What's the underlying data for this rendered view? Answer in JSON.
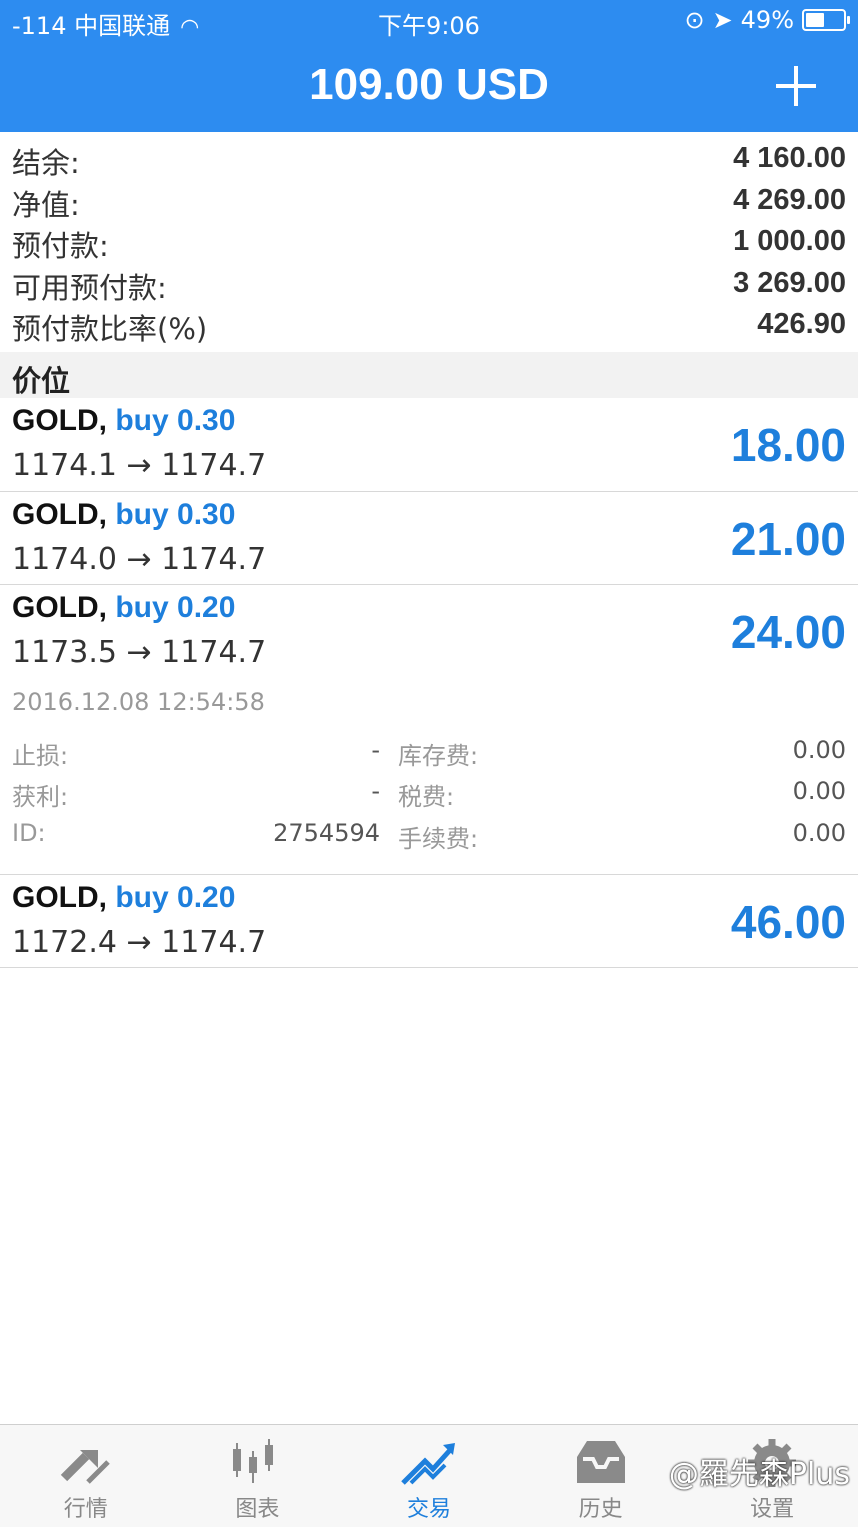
{
  "status_bar": {
    "carrier": "-114 中国联通",
    "time": "下午9:06",
    "battery": "49%",
    "battery_level": 0.49
  },
  "header": {
    "title": "109.00 USD"
  },
  "summary": [
    {
      "label": "结余:",
      "value": "4 160.00"
    },
    {
      "label": "净值:",
      "value": "4 269.00"
    },
    {
      "label": "预付款:",
      "value": "1 000.00"
    },
    {
      "label": "可用预付款:",
      "value": "3 269.00"
    },
    {
      "label": "预付款比率(%)",
      "value": "426.90"
    }
  ],
  "section_title": "价位",
  "positions": [
    {
      "symbol": "GOLD,",
      "side": "buy 0.30",
      "prices": "1174.1 → 1174.7",
      "profit": "18.00"
    },
    {
      "symbol": "GOLD,",
      "side": "buy 0.30",
      "prices": "1174.0 → 1174.7",
      "profit": "21.00"
    },
    {
      "symbol": "GOLD,",
      "side": "buy 0.20",
      "prices": "1173.5 → 1174.7",
      "profit": "24.00"
    },
    {
      "symbol": "GOLD,",
      "side": "buy 0.20",
      "prices": "1172.4 → 1174.7",
      "profit": "46.00"
    }
  ],
  "details": {
    "time": "2016.12.08 12:54:58",
    "rows": [
      {
        "k1": "止损:",
        "v1": "-",
        "k2": "库存费:",
        "v2": "0.00"
      },
      {
        "k1": "获利:",
        "v1": "-",
        "k2": "税费:",
        "v2": "0.00"
      },
      {
        "k1": "ID:",
        "v1": "2754594",
        "k2": "手续费:",
        "v2": "0.00"
      }
    ]
  },
  "tabs": [
    {
      "label": "行情",
      "icon": "quotes-arrows-icon"
    },
    {
      "label": "图表",
      "icon": "candlestick-chart-icon"
    },
    {
      "label": "交易",
      "icon": "trade-trend-icon",
      "active": true
    },
    {
      "label": "历史",
      "icon": "history-inbox-icon"
    },
    {
      "label": "设置",
      "icon": "settings-gear-icon"
    }
  ],
  "watermark": "@羅先森Plus",
  "colors": {
    "accent": "#2d8cf0",
    "profit_blue": "#1e7fdc"
  }
}
